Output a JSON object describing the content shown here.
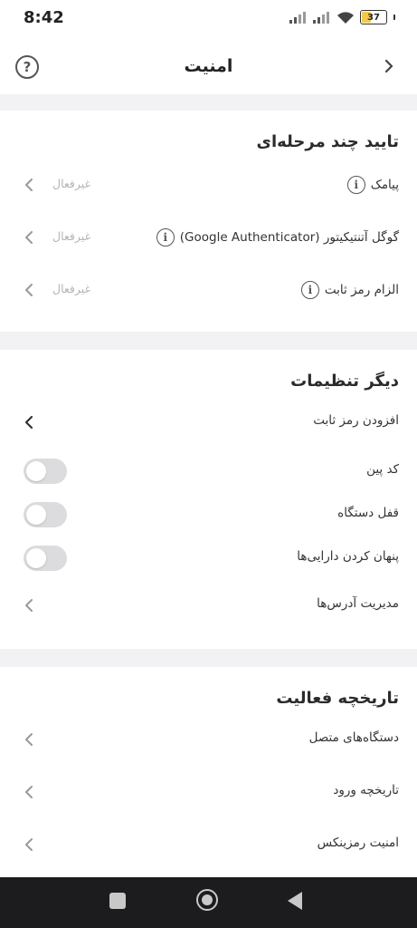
{
  "status": {
    "time": "8:42",
    "battery": "37",
    "battery_level": 0.37
  },
  "header": {
    "title": "امنیت",
    "help": "?"
  },
  "two_factor": {
    "title": "تایید چند مرحله‌ای",
    "items": [
      {
        "label": "پیامک",
        "value": "غیرفعال"
      },
      {
        "label": "گوگل آتنتیکیتور (Google Authenticator)",
        "value": "غیرفعال"
      },
      {
        "label": "الزام رمز ثابت",
        "value": "غیرفعال"
      }
    ]
  },
  "other_settings": {
    "title": "دیگر تنظیمات",
    "items": [
      {
        "label": "افزودن رمز ثابت"
      },
      {
        "label": "کد پین",
        "enabled": false
      },
      {
        "label": "قفل دستگاه",
        "enabled": false
      },
      {
        "label": "پنهان کردن دارایی‌ها",
        "enabled": false
      },
      {
        "label": "مدیریت آدرس‌ها"
      }
    ]
  },
  "activity": {
    "title": "تاریخچه فعالیت",
    "items": [
      {
        "label": "دستگاه‌های متصل"
      },
      {
        "label": "تاریخچه ورود"
      },
      {
        "label": "امنیت رمزینکس"
      }
    ]
  },
  "colors": {
    "accent_text": "#2b2b2b",
    "muted": "#b4b4b8",
    "toggle_off": "#dcdcdf",
    "battery": "#f2c94c"
  },
  "icons": [
    "signal-icon",
    "wifi-icon",
    "battery-icon",
    "help-icon",
    "back-arrow-icon",
    "info-icon",
    "chevron-left-icon"
  ]
}
